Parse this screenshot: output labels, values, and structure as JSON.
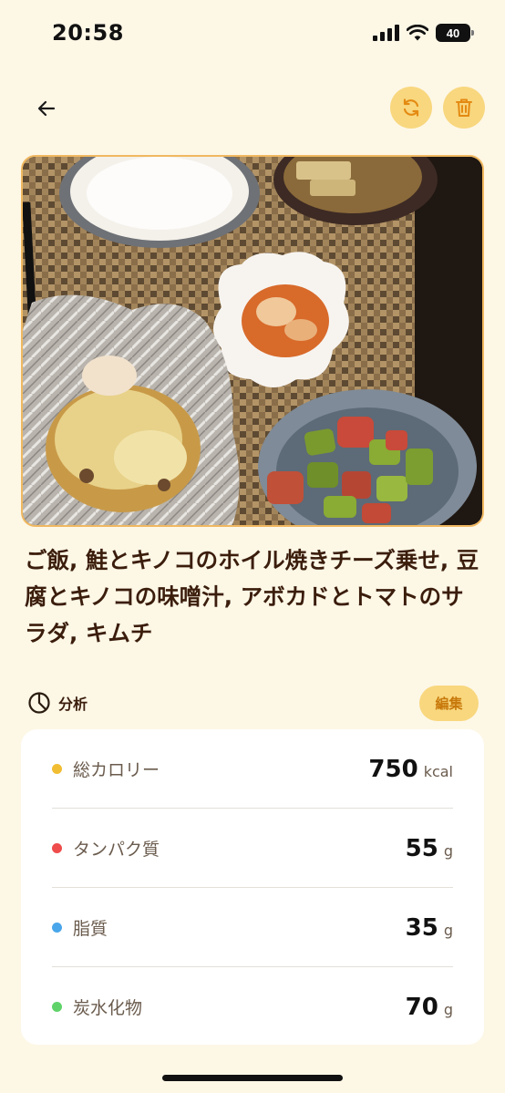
{
  "status_bar": {
    "time": "20:58",
    "battery": "40"
  },
  "header": {
    "back_icon": "arrow-left-icon",
    "refresh_icon": "refresh-icon",
    "delete_icon": "trash-icon",
    "accent_color": "#f8d77e"
  },
  "meal": {
    "photo_description_icon": "meal-photo",
    "title": "ご飯, 鮭とキノコのホイル焼きチーズ乗せ, 豆腐とキノコの味噌汁, アボカドとトマトのサラダ, キムチ"
  },
  "analysis": {
    "label": "分析",
    "icon": "pie-chart-icon",
    "edit_label": "編集",
    "rows": [
      {
        "label": "総カロリー",
        "value": "750",
        "unit": "kcal",
        "color": "#f1bd32"
      },
      {
        "label": "タンパク質",
        "value": "55",
        "unit": "g",
        "color": "#ef4c4c"
      },
      {
        "label": "脂質",
        "value": "35",
        "unit": "g",
        "color": "#4aa6ea"
      },
      {
        "label": "炭水化物",
        "value": "70",
        "unit": "g",
        "color": "#5fd36a"
      }
    ]
  }
}
